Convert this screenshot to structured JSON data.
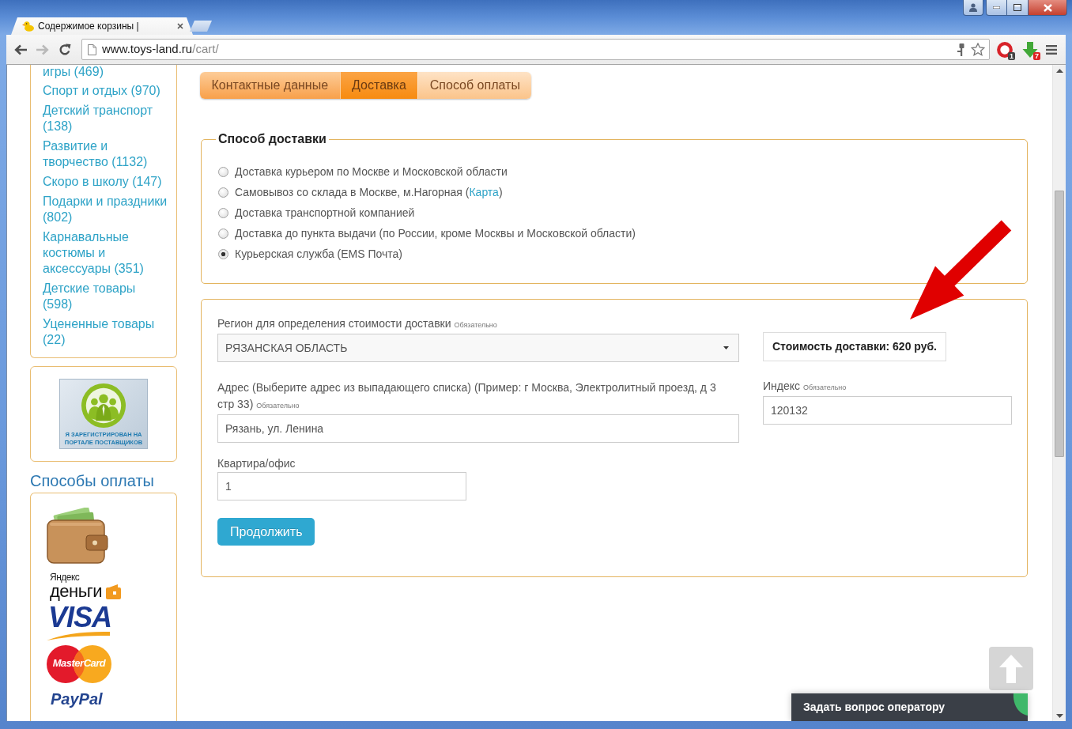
{
  "browser": {
    "tabs": [
      {
        "title": "Содержимое корзины |",
        "selected": true
      }
    ],
    "nav_buttons": [
      {
        "kind": "back",
        "disabled": false
      },
      {
        "kind": "forward",
        "disabled": true
      },
      {
        "kind": "reload",
        "disabled": false
      }
    ],
    "address": {
      "host": "www.toys-land.ru",
      "path": "/cart/"
    },
    "extensions": [
      {
        "kind": "blocker",
        "badge": "1"
      },
      {
        "kind": "download",
        "badge": "7"
      }
    ]
  },
  "sidebar": {
    "categories": [
      "игры (469)",
      "Спорт и отдых (970)",
      "Детский транспорт (138)",
      "Развитие и творчество (1132)",
      "Скоро в школу (147)",
      "Подарки и праздники (802)",
      "Карнавальные костюмы и аксессуары (351)",
      "Детские товары (598)",
      "Уцененные товары (22)"
    ],
    "supplier_banner": {
      "text": "Я ЗАРЕГИСТРИРОВАН НА ПОРТАЛЕ ПОСТАВЩИКОВ"
    },
    "payment_heading": "Способы оплаты",
    "payment_logos": [
      {
        "kind": "wallet"
      },
      {
        "kind": "yandex_money",
        "brand": "Яндекс",
        "product": "деньги"
      },
      {
        "kind": "visa",
        "label": "VISA"
      },
      {
        "kind": "mastercard",
        "label": "MasterCard"
      },
      {
        "kind": "paypal",
        "label": "PayPal"
      }
    ]
  },
  "checkout_tabs": [
    {
      "label": "Контактные данные",
      "selected": false,
      "completed": true
    },
    {
      "label": "Доставка",
      "selected": true,
      "completed": false
    },
    {
      "label": "Способ оплаты",
      "selected": false,
      "completed": false
    }
  ],
  "delivery_method": {
    "legend": "Способ доставки",
    "options": [
      {
        "label": "Доставка курьером по Москве и Московской области",
        "selected": false
      },
      {
        "label": "Самовывоз со склада в Москве, м.Нагорная (",
        "link": "Карта",
        "label_end": ")",
        "selected": false
      },
      {
        "label": "Доставка транспортной компанией",
        "selected": false
      },
      {
        "label": "Доставка до пункта выдачи (по России, кроме Москвы и Московской области)",
        "selected": false
      },
      {
        "label": "Курьерская служба (EMS Почта)",
        "selected": true
      }
    ]
  },
  "delivery_form": {
    "region": {
      "label": "Регион для определения стоимости доставки",
      "required_note": "Обязательно",
      "value": "РЯЗАНСКАЯ ОБЛАСТЬ"
    },
    "address": {
      "label": "Адрес (Выберите адрес из выпадающего списка) (Пример: г Москва, Электролитный проезд, д 3 стр 33)",
      "required_note": "Обязательно",
      "value": "Рязань, ул. Ленина"
    },
    "apartment": {
      "label": "Квартира/офис",
      "value": "1"
    },
    "continue_button": "Продолжить",
    "delivery_cost": "Стоимость доставки: 620 руб.",
    "postcode": {
      "label": "Индекс",
      "required_note": "Обязательно",
      "value": "120132"
    }
  },
  "chat_widget": {
    "label": "Задать вопрос оператору"
  }
}
